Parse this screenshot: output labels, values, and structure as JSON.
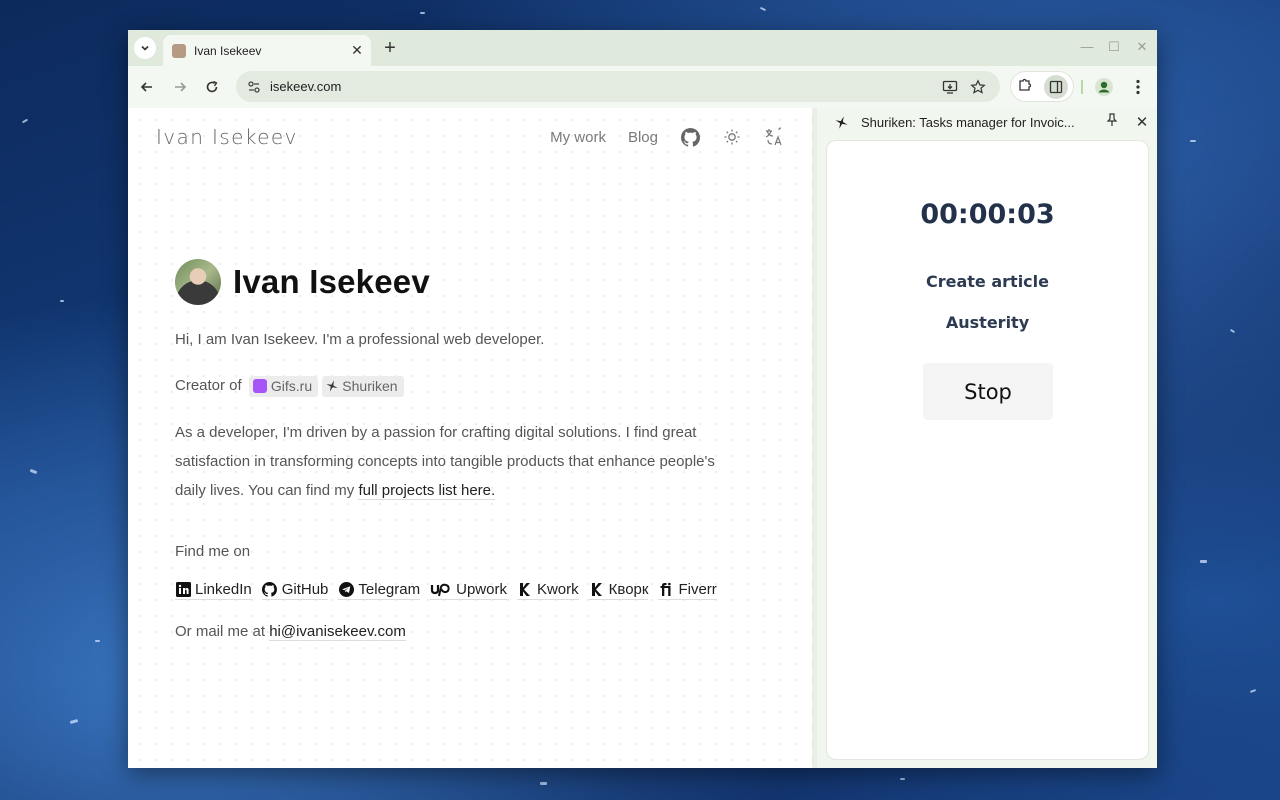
{
  "browser": {
    "tab_title": "Ivan Isekeev",
    "url": "isekeev.com",
    "accent": "#dfe9dc"
  },
  "site": {
    "logo": "Ivan Isekeev",
    "nav": {
      "my_work": "My work",
      "blog": "Blog"
    },
    "hero_name": "Ivan Isekeev",
    "intro": "Hi, I am Ivan Isekeev. I'm a professional web developer.",
    "creator_prefix": "Creator of",
    "creations": [
      {
        "label": "Gifs.ru"
      },
      {
        "label": "Shuriken"
      }
    ],
    "about_line1": "As a developer, I'm driven by a passion for crafting digital solutions. I find great",
    "about_line2": "satisfaction in transforming concepts into tangible products that enhance people's",
    "about_line3_prefix": "daily lives. You can find my",
    "about_link": "full projects list here.",
    "find_me": "Find me on",
    "social": [
      {
        "label": "LinkedIn",
        "icon": "linkedin-icon"
      },
      {
        "label": "GitHub",
        "icon": "github-icon"
      },
      {
        "label": "Telegram",
        "icon": "telegram-icon"
      },
      {
        "label": "Upwork",
        "icon": "upwork-icon"
      },
      {
        "label": "Kwork",
        "icon": "kwork-icon"
      },
      {
        "label": "Кворк",
        "icon": "kwork-icon"
      },
      {
        "label": "Fiverr",
        "icon": "fiverr-icon"
      }
    ],
    "mail_prefix": "Or mail me at",
    "email": "hi@ivanisekeev.com"
  },
  "side_panel": {
    "title": "Shuriken: Tasks manager for Invoic...",
    "timer": "00:00:03",
    "task_name": "Create article",
    "project_name": "Austerity",
    "stop_label": "Stop"
  }
}
